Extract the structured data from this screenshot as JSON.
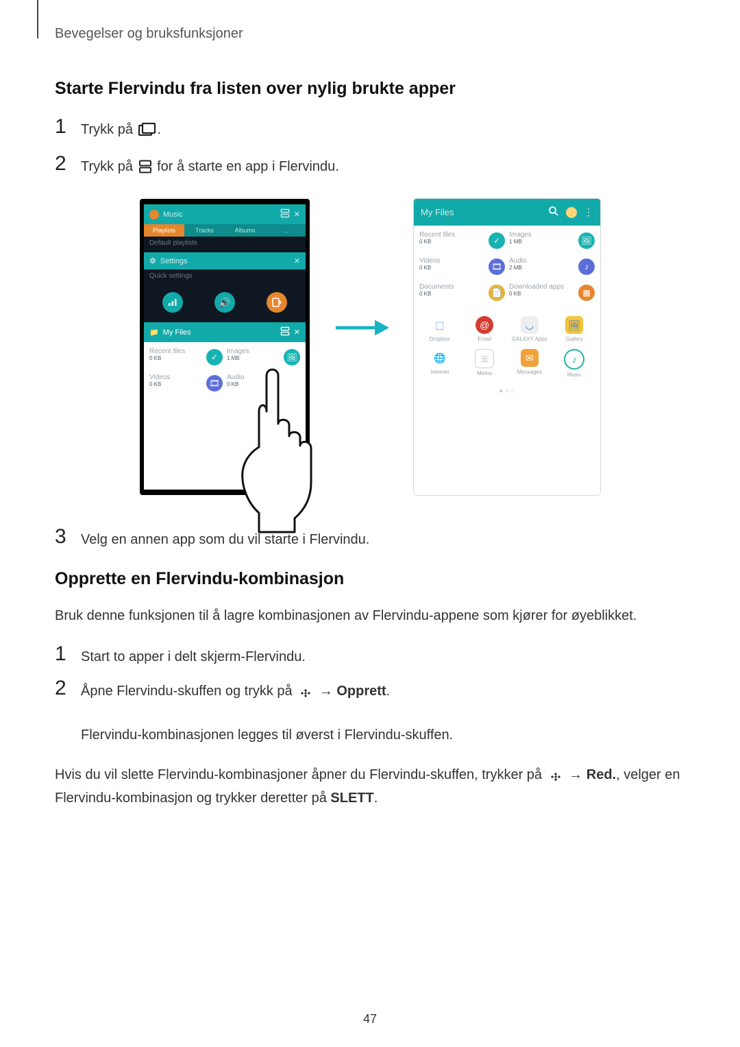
{
  "running_head": "Bevegelser og bruksfunksjoner",
  "page_number": "47",
  "section1": {
    "heading": "Starte Flervindu fra listen over nylig brukte apper",
    "steps": {
      "s1": {
        "num": "1",
        "text_a": "Trykk på ",
        "text_b": "."
      },
      "s2": {
        "num": "2",
        "text_a": "Trykk på ",
        "text_b": " for å starte en app i Flervindu."
      },
      "s3": {
        "num": "3",
        "text": "Velg en annen app som du vil starte i Flervindu."
      }
    }
  },
  "section2": {
    "heading": "Opprette en Flervindu-kombinasjon",
    "intro": "Bruk denne funksjonen til å lagre kombinasjonen av Flervindu-appene som kjører for øyeblikket.",
    "steps": {
      "s1": {
        "num": "1",
        "text": "Start to apper i delt skjerm-Flervindu."
      },
      "s2": {
        "num": "2",
        "line1_a": "Åpne Flervindu-skuffen og trykk på ",
        "line1_arrow": " → ",
        "line1_bold": "Opprett",
        "line1_end": ".",
        "line2": "Flervindu-kombinasjonen legges til øverst i Flervindu-skuffen."
      }
    },
    "para2_a": "Hvis du vil slette Flervindu-kombinasjoner åpner du Flervindu-skuffen, trykker på ",
    "para2_arrow": " → ",
    "para2_bold": "Red.",
    "para2_b": ", velger en Flervindu-kombinasjon og trykker deretter på ",
    "para2_bold2": "SLETT",
    "para2_end": "."
  },
  "illus": {
    "left": {
      "music": {
        "title": "Music",
        "tab1": "Playlists",
        "tab2": "Tracks",
        "tab3": "Albums",
        "tab4": "…",
        "sub": "Default playlists"
      },
      "settings": {
        "title": "Settings",
        "sub": "Quick settings"
      },
      "files": {
        "title": "My Files",
        "recent": "Recent files",
        "recent_sub": "0 KB",
        "images": "Images",
        "images_sub": "1 MB",
        "videos": "Videos",
        "videos_sub": "0 KB",
        "audio": "Audio",
        "audio_sub": "0 KB"
      }
    },
    "right": {
      "head": "My Files",
      "recent": "Recent files",
      "recent_sub": "0 KB",
      "images": "Images",
      "images_sub": "1 MB",
      "videos": "Videos",
      "videos_sub": "0 KB",
      "audio": "Audio",
      "audio_sub": "2 MB",
      "documents": "Documents",
      "documents_sub": "0 KB",
      "downloaded": "Downloaded apps",
      "downloaded_sub": "0 KB",
      "apps": [
        "Dropbox",
        "Email",
        "GALAXY Apps",
        "Gallery",
        "Internet",
        "Memo",
        "Messages",
        "Music"
      ]
    }
  },
  "icons": {
    "recent": "recent-apps-icon",
    "split": "split-view-icon",
    "more_dots": "more-dots-icon",
    "search": "search-icon",
    "close": "close-icon",
    "menu": "menu-icon"
  }
}
